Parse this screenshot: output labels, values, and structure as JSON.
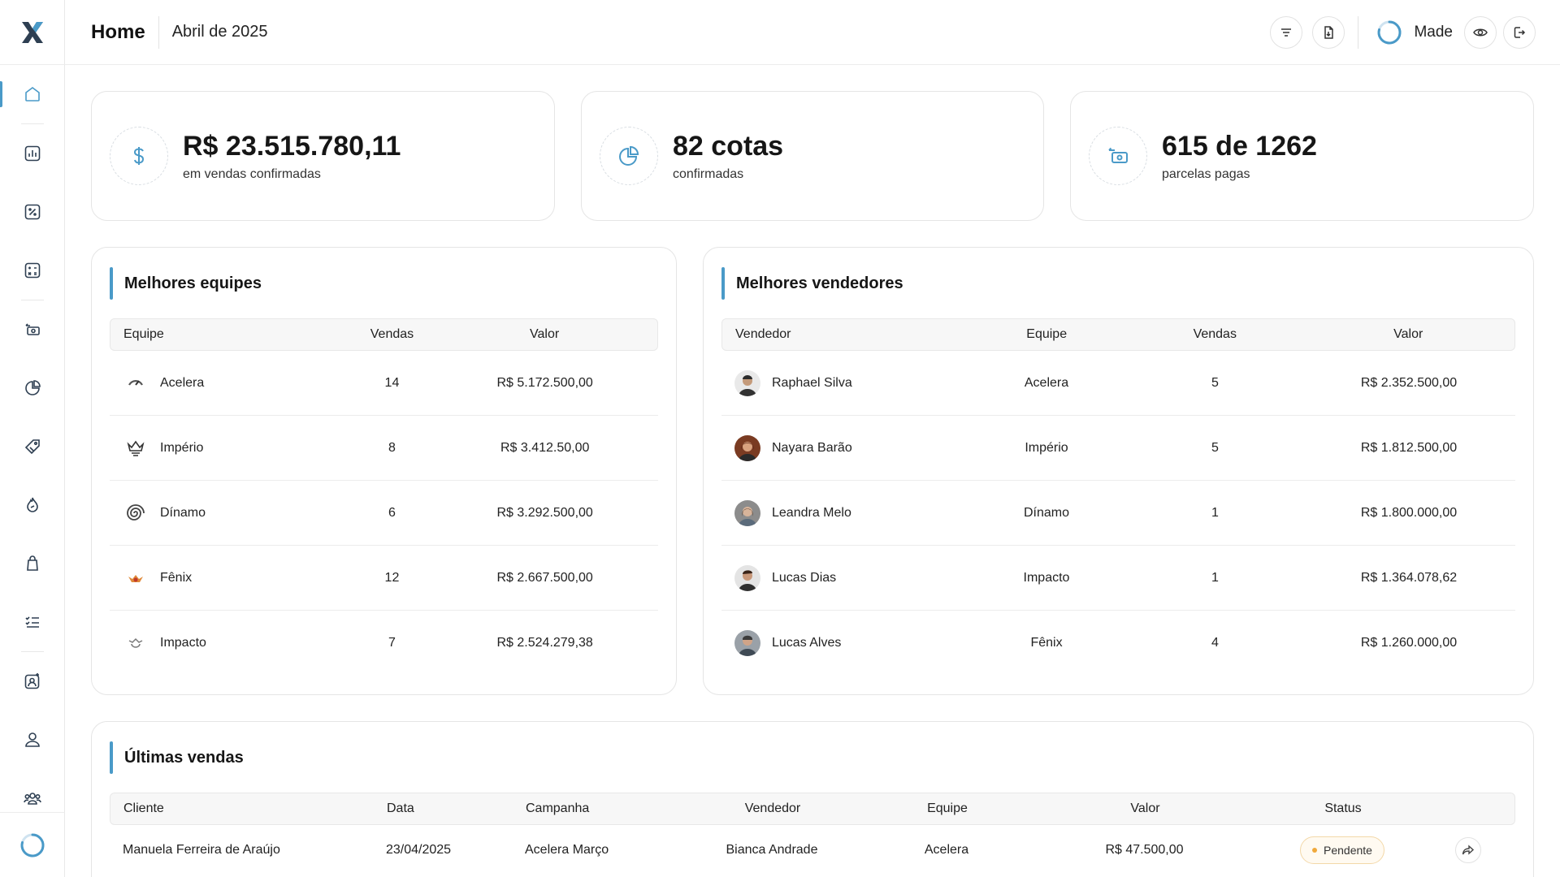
{
  "header": {
    "title": "Home",
    "period": "Abril de 2025",
    "user_name": "Made"
  },
  "stats": [
    {
      "value": "R$ 23.515.780,11",
      "label": "em vendas confirmadas",
      "icon": "dollar-icon"
    },
    {
      "value": "82 cotas",
      "label": "confirmadas",
      "icon": "pie-chart-icon"
    },
    {
      "value": "615 de 1262",
      "label": "parcelas pagas",
      "icon": "cash-icon"
    }
  ],
  "best_teams": {
    "title": "Melhores equipes",
    "columns": [
      "Equipe",
      "Vendas",
      "Valor"
    ],
    "rows": [
      {
        "team": "Acelera",
        "sales": "14",
        "value": "R$ 5.172.500,00"
      },
      {
        "team": "Império",
        "sales": "8",
        "value": "R$ 3.412.50,00"
      },
      {
        "team": "Dínamo",
        "sales": "6",
        "value": "R$ 3.292.500,00"
      },
      {
        "team": "Fênix",
        "sales": "12",
        "value": "R$ 2.667.500,00"
      },
      {
        "team": "Impacto",
        "sales": "7",
        "value": "R$ 2.524.279,38"
      }
    ]
  },
  "best_sellers": {
    "title": "Melhores vendedores",
    "columns": [
      "Vendedor",
      "Equipe",
      "Vendas",
      "Valor"
    ],
    "rows": [
      {
        "seller": "Raphael Silva",
        "team": "Acelera",
        "sales": "5",
        "value": "R$ 2.352.500,00"
      },
      {
        "seller": "Nayara Barão",
        "team": "Império",
        "sales": "5",
        "value": "R$ 1.812.500,00"
      },
      {
        "seller": "Leandra Melo",
        "team": "Dínamo",
        "sales": "1",
        "value": "R$ 1.800.000,00"
      },
      {
        "seller": "Lucas Dias",
        "team": "Impacto",
        "sales": "1",
        "value": "R$ 1.364.078,62"
      },
      {
        "seller": "Lucas Alves",
        "team": "Fênix",
        "sales": "4",
        "value": "R$ 1.260.000,00"
      }
    ]
  },
  "recent_sales": {
    "title": "Últimas vendas",
    "columns": [
      "Cliente",
      "Data",
      "Campanha",
      "Vendedor",
      "Equipe",
      "Valor",
      "Status"
    ],
    "rows": [
      {
        "client": "Manuela Ferreira de Araújo",
        "date": "23/04/2025",
        "campaign": "Acelera Março",
        "seller": "Bianca Andrade",
        "team": "Acelera",
        "value": "R$ 47.500,00",
        "status": "Pendente"
      }
    ]
  },
  "colors": {
    "accent": "#4a9ac8",
    "pending": "#f0a93b"
  }
}
